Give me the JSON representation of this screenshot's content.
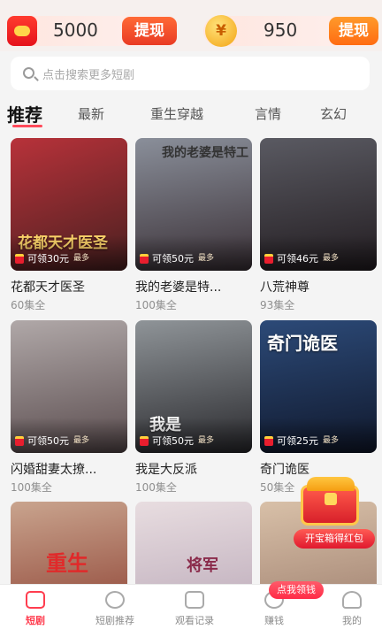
{
  "balance": {
    "coins": "5000",
    "coin_withdraw": "提现",
    "cash_symbol": "¥",
    "cash": "950",
    "cash_withdraw": "提现"
  },
  "search": {
    "placeholder": "点击搜索更多短剧"
  },
  "tabs": [
    {
      "label": "推荐",
      "active": true
    },
    {
      "label": "最新"
    },
    {
      "label": "重生穿越"
    },
    {
      "label": "言情"
    },
    {
      "label": "玄幻"
    }
  ],
  "dramas": [
    {
      "title": "花都天才医圣",
      "episodes": "60集全",
      "reward": "可领30元",
      "reward_suffix": "最多",
      "poster_text": "花都天才医圣",
      "colors": [
        "#b8323a",
        "#4a2020"
      ]
    },
    {
      "title": "我的老婆是特...",
      "episodes": "100集全",
      "reward": "可领50元",
      "reward_suffix": "最多",
      "poster_text": "我的老婆是特工",
      "colors": [
        "#8a8f9a",
        "#3a3036"
      ]
    },
    {
      "title": "八荒神尊",
      "episodes": "93集全",
      "reward": "可领46元",
      "reward_suffix": "最多",
      "poster_text": "",
      "colors": [
        "#5a5a62",
        "#221c20"
      ]
    },
    {
      "title": "闪婚甜妻太撩...",
      "episodes": "100集全",
      "reward": "可领50元",
      "reward_suffix": "最多",
      "poster_text": "",
      "colors": [
        "#b0a8a8",
        "#5a4c4e"
      ]
    },
    {
      "title": "我是大反派",
      "episodes": "100集全",
      "reward": "可领50元",
      "reward_suffix": "最多",
      "poster_text": "我是",
      "colors": [
        "#8f9498",
        "#2a2a2e"
      ]
    },
    {
      "title": "奇门诡医",
      "episodes": "50集全",
      "reward": "可领25元",
      "reward_suffix": "最多",
      "poster_text": "奇门诡医",
      "colors": [
        "#2c4a78",
        "#10182c"
      ]
    },
    {
      "title": "",
      "episodes": "",
      "reward": "",
      "reward_suffix": "",
      "poster_text": "重生",
      "colors": [
        "#c9a48e",
        "#8a3c2e"
      ]
    },
    {
      "title": "",
      "episodes": "",
      "reward": "",
      "reward_suffix": "",
      "poster_text": "将军",
      "colors": [
        "#e8dde0",
        "#b8a6b6"
      ]
    },
    {
      "title": "",
      "episodes": "",
      "reward": "",
      "reward_suffix": "",
      "poster_text": "",
      "colors": [
        "#d8c0a8",
        "#9a7a6a"
      ]
    }
  ],
  "float_reward": {
    "label": "开宝箱得红包"
  },
  "nav": {
    "cash_badge": "点我领钱",
    "items": [
      {
        "label": "短剧",
        "icon": "drama-icon",
        "active": true
      },
      {
        "label": "短剧推荐",
        "icon": "compass-icon"
      },
      {
        "label": "观看记录",
        "icon": "bookmark-icon"
      },
      {
        "label": "赚钱",
        "icon": "money-icon"
      },
      {
        "label": "我的",
        "icon": "person-icon"
      }
    ]
  },
  "accent_color": "#ff3d4f"
}
